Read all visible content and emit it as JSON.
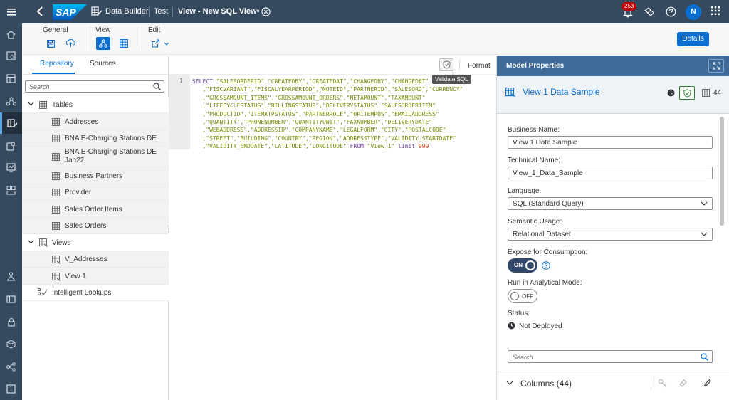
{
  "shell": {
    "logo_text": "SAP",
    "breadcrumb_app": "Data Builder",
    "breadcrumb_space": "Test",
    "breadcrumb_object": "View - New SQL View",
    "notification_count": "253",
    "avatar_initial": "N"
  },
  "toolbar": {
    "general_label": "General",
    "view_label": "View",
    "edit_label": "Edit",
    "details_label": "Details"
  },
  "repository": {
    "tabs": [
      "Repository",
      "Sources"
    ],
    "search_placeholder": "Search",
    "tables_header": "Tables",
    "tables": [
      "Addresses",
      "BNA E-Charging Stations DE",
      "BNA E-Charging Stations DE Jan22",
      "Business Partners",
      "Provider",
      "Sales Order Items",
      "Sales Orders"
    ],
    "views_header": "Views",
    "views": [
      "V_Addresses",
      "View 1"
    ],
    "lookups_label": "Intelligent Lookups"
  },
  "editor": {
    "format_label": "Format",
    "validate_tooltip": "Validate SQL",
    "line_number": "1",
    "code_keyword": "SELECT",
    "code_lines": [
      "\"SALESORDERID\",\"CREATEDBY\",\"CREATEDAT\",\"CHANGEDBY\",\"CHANGEDAT\"",
      "   ,\"FISCVARIANT\",\"FISCALYEARPERIOD\",\"NOTEID\",\"PARTNERID\",\"SALESORG\",\"CURRENCY\"",
      "   ,\"GROSSAMOUNT_ITEMS\",\"GROSSAMOUNT_ORDERS\",\"NETAMOUNT\",\"TAXAMOUNT\"",
      "   ,\"LIFECYCLESTATUS\",\"BILLINGSTATUS\",\"DELIVERYSTATUS\",\"SALESORDERITEM\"",
      "   ,\"PRODUCTID\",\"ITEMATPSTATUS\",\"PARTNERROLE\",\"OPITEMPOS\",\"EMAILADDRESS\"",
      "   ,\"QUANTITY\",\"PHONENUMBER\",\"QUANTITYUNIT\",\"FAXNUMBER\",\"DELIVERYDATE\"",
      "   ,\"WEBADDRESS\",\"ADDRESSID\",\"COMPANYNAME\",\"LEGALFORM\",\"CITY\",\"POSTALCODE\"",
      "   ,\"STREET\",\"BUILDING\",\"COUNTRY\",\"REGION\",\"ADDRESSTYPE\",\"VALIDITY_STARTDATE\""
    ],
    "last_line_cols": "   ,\"VALIDITY_ENDDATE\",\"LATITUDE\",\"LONGITUDE\"",
    "last_line_from": "FROM",
    "last_line_source": "\"View_1\"",
    "last_line_limit": "limit",
    "last_line_number": "999"
  },
  "model_properties": {
    "header": "Model Properties",
    "title": "View 1 Data Sample",
    "column_count": "44",
    "business_name_label": "Business Name:",
    "business_name_value": "View 1 Data Sample",
    "technical_name_label": "Technical Name:",
    "technical_name_value": "View_1_Data_Sample",
    "language_label": "Language:",
    "language_value": "SQL (Standard Query)",
    "semantic_label": "Semantic Usage:",
    "semantic_value": "Relational Dataset",
    "expose_label": "Expose for Consumption:",
    "expose_state": "ON",
    "analytical_label": "Run in Analytical Mode:",
    "analytical_state": "OFF",
    "status_label": "Status:",
    "status_value": "Not Deployed",
    "search_placeholder": "Search",
    "columns_title": "Columns (44)"
  }
}
